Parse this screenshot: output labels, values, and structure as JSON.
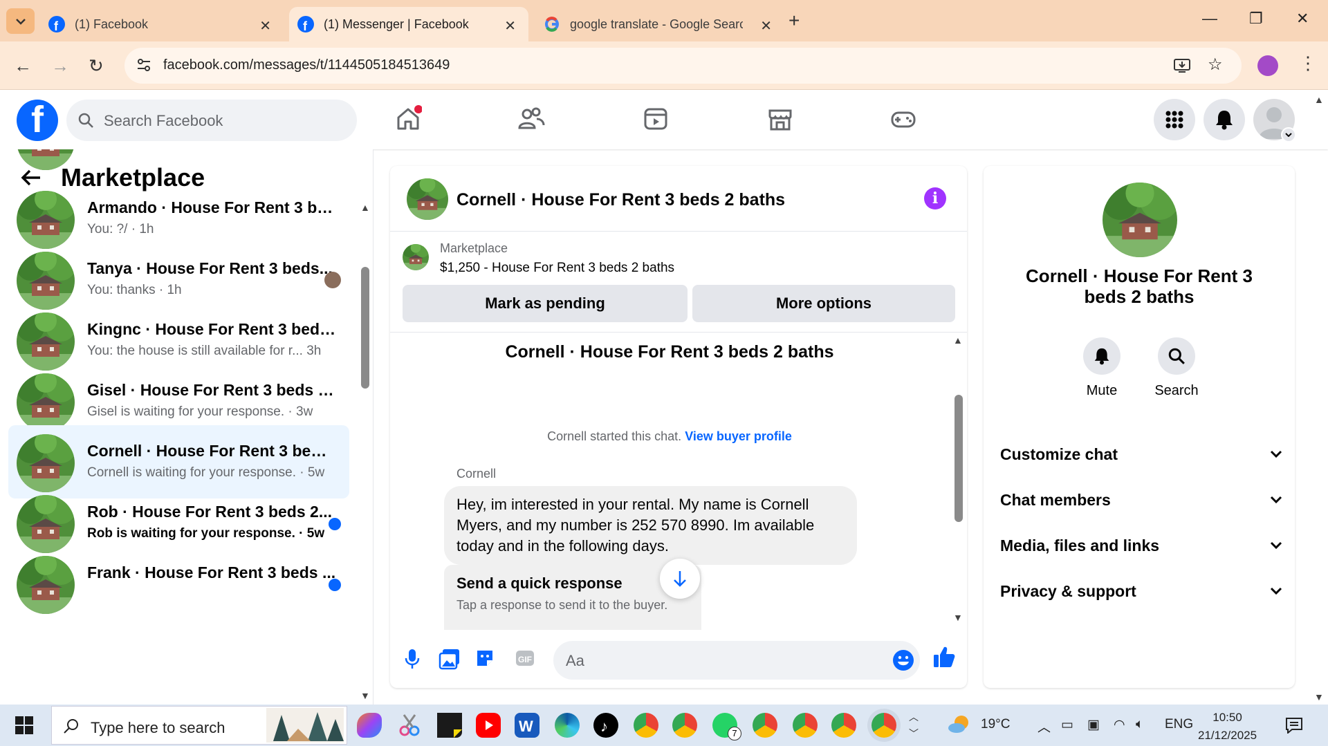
{
  "browser": {
    "tabs": [
      {
        "title": "(1) Facebook",
        "active": false
      },
      {
        "title": "(1) Messenger | Facebook",
        "active": true
      },
      {
        "title": "google translate - Google Searc",
        "active": false
      }
    ],
    "url": "facebook.com/messages/t/1144505184513649"
  },
  "facebook": {
    "search_placeholder": "Search Facebook"
  },
  "left_panel": {
    "title": "Marketplace",
    "conversations": [
      {
        "name": "Armando · House For Rent 3 be...",
        "preview": "You: ?/ · 1h",
        "unread": false,
        "selected": false
      },
      {
        "name": "Tanya · House For Rent 3 beds...",
        "preview": "You: thanks · 1h",
        "unread": false,
        "selected": false
      },
      {
        "name": "Kingnc · House For Rent 3 beds ...",
        "preview": "You: the house is still available for r...  3h",
        "unread": false,
        "selected": false
      },
      {
        "name": "Gisel · House For Rent 3 beds 2 ...",
        "preview": "Gisel is waiting for your response. · 3w",
        "unread": false,
        "selected": false
      },
      {
        "name": "Cornell · House For Rent 3 beds ...",
        "preview": "Cornell is waiting for your response. · 5w",
        "unread": false,
        "selected": true
      },
      {
        "name": "Rob · House For Rent 3 beds 2...",
        "preview": "Rob is waiting for your response. · 5w",
        "unread": true,
        "selected": false
      },
      {
        "name": "Frank · House For Rent 3 beds ...",
        "preview": "",
        "unread": true,
        "selected": false
      }
    ]
  },
  "chat": {
    "title": "Cornell · House For Rent 3 beds 2 baths",
    "marketplace_label": "Marketplace",
    "listing": "$1,250 - House For Rent 3 beds 2 baths",
    "mark_pending": "Mark as pending",
    "more_options": "More options",
    "thread_title": "Cornell · House For Rent 3 beds 2 baths",
    "started_text": "Cornell started this chat.",
    "buyer_profile_link": "View buyer profile",
    "sender": "Cornell",
    "message": "Hey, im interested in your rental. My name is Cornell Myers, and my number is 252 570 8990. Im available today and in the following days.",
    "quick_title": "Send a quick response",
    "quick_sub": "Tap a response to send it to the buyer.",
    "composer_placeholder": "Aa"
  },
  "right_panel": {
    "name": "Cornell · House For Rent 3 beds 2 baths",
    "actions": [
      {
        "label": "Mute",
        "icon": "bell-icon"
      },
      {
        "label": "Search",
        "icon": "search-icon"
      }
    ],
    "sections": [
      "Customize chat",
      "Chat members",
      "Media, files and links",
      "Privacy & support"
    ]
  },
  "taskbar": {
    "search_placeholder": "Type here to search",
    "weather": "19°C",
    "language": "ENG",
    "time": "10:50",
    "date": "21/12/2025",
    "whatsapp_badge": "7"
  },
  "colors": {
    "facebook_blue": "#0866ff",
    "tab_bar": "#f8d6b9",
    "selected_conversation": "#ebf5ff",
    "info_purple": "#a033ff"
  }
}
